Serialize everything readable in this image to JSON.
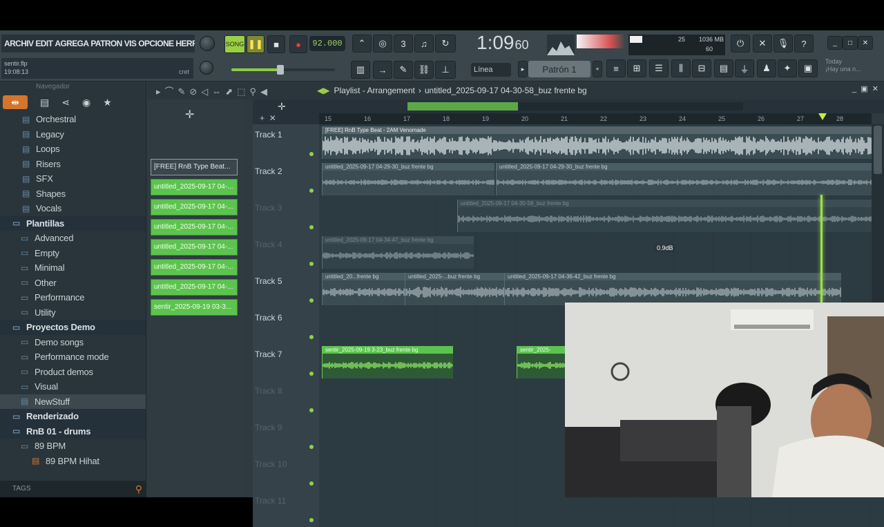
{
  "menu": {
    "items": [
      "ARCHIV",
      "EDIT",
      "AGREGA",
      "PATRON",
      "VIS",
      "OPCIONE",
      "HERRAMIENTA"
    ]
  },
  "song": {
    "file": "sentir.flp",
    "time": "19:08:13",
    "hint": "cret"
  },
  "transport": {
    "tempo": "92.000",
    "time_main": "1:09",
    "time_sub": "60"
  },
  "cpu": {
    "val1": "25",
    "val2": "1036 MB",
    "val3": "60"
  },
  "snap": {
    "label": "Línea"
  },
  "pattern_selector": {
    "label": "Patrón 1"
  },
  "hint_right": {
    "line1": "Today",
    "line2": "¡Hay una n..."
  },
  "browser": {
    "title": "Navegador",
    "items": [
      {
        "label": "Orchestral",
        "type": "file"
      },
      {
        "label": "Legacy",
        "type": "file"
      },
      {
        "label": "Loops",
        "type": "file"
      },
      {
        "label": "Risers",
        "type": "file"
      },
      {
        "label": "SFX",
        "type": "file"
      },
      {
        "label": "Shapes",
        "type": "file"
      },
      {
        "label": "Vocals",
        "type": "file"
      },
      {
        "label": "Plantillas",
        "type": "section"
      },
      {
        "label": "Advanced",
        "type": "folder"
      },
      {
        "label": "Empty",
        "type": "folder"
      },
      {
        "label": "Minimal",
        "type": "folder"
      },
      {
        "label": "Other",
        "type": "folder"
      },
      {
        "label": "Performance",
        "type": "folder"
      },
      {
        "label": "Utility",
        "type": "folder"
      },
      {
        "label": "Proyectos Demo",
        "type": "section"
      },
      {
        "label": "Demo songs",
        "type": "folder"
      },
      {
        "label": "Performance mode",
        "type": "folder"
      },
      {
        "label": "Product demos",
        "type": "folder"
      },
      {
        "label": "Visual",
        "type": "folder"
      },
      {
        "label": "NewStuff",
        "type": "selected"
      },
      {
        "label": "Renderizado",
        "type": "section"
      },
      {
        "label": "RnB 01 - drums",
        "type": "section"
      },
      {
        "label": "89 BPM",
        "type": "folder"
      },
      {
        "label": "89 BPM Hihat",
        "type": "sub"
      }
    ],
    "tags_label": "TAGS"
  },
  "patterns": [
    "[FREE] RnB Type Beat...",
    "untitled_2025-09-17 04-...",
    "untitled_2025-09-17 04-...",
    "untitled_2025-09-17 04-...",
    "untitled_2025-09-17 04-...",
    "untitled_2025-09-17 04-...",
    "untitled_2025-09-17 04-...",
    "sentir_2025-09-19 03-3..."
  ],
  "playlist": {
    "title": "Playlist - Arrangement",
    "separator": "›",
    "subtitle": "untitled_2025-09-17 04-30-58_buz frente bg",
    "ruler": [
      "15",
      "16",
      "17",
      "18",
      "19",
      "20",
      "21",
      "22",
      "23",
      "24",
      "25",
      "26",
      "27",
      "28"
    ],
    "tooltip": "0.9dB"
  },
  "tracks": [
    {
      "name": "Track 1",
      "dim": false,
      "clips": [
        {
          "label": "[FREE] RnB Type Beat - 2AM Venomade",
          "style": "white"
        }
      ]
    },
    {
      "name": "Track 2",
      "dim": false,
      "clips": [
        {
          "label": "untitled_2025-09-17 04-29-30_buz frente bg",
          "style": "normal"
        },
        {
          "label": "untitled_2025-09-17 04-29-30_buz frente bg",
          "style": "normal"
        }
      ]
    },
    {
      "name": "Track 3",
      "dim": true,
      "clips": [
        {
          "label": "untitled_2025-09-17 04-30-58_buz frente bg",
          "style": "normal"
        }
      ]
    },
    {
      "name": "Track 4",
      "dim": true,
      "clips": [
        {
          "label": "untitled_2025-09-17 04-34-47_buz frente bg",
          "style": "normal"
        }
      ]
    },
    {
      "name": "Track 5",
      "dim": false,
      "clips": [
        {
          "label": "untitled_20...frente bg",
          "style": "normal"
        },
        {
          "label": "untitled_2025-...buz frente bg",
          "style": "normal"
        },
        {
          "label": "untitled_2025-09-17 04-36-42_buz frente bg",
          "style": "normal"
        }
      ]
    },
    {
      "name": "Track 6",
      "dim": false,
      "clips": []
    },
    {
      "name": "Track 7",
      "dim": false,
      "clips": [
        {
          "label": "sentir_2025-09-19 3-23_buz frente bg",
          "style": "green"
        },
        {
          "label": "sentir_2025-",
          "style": "green"
        }
      ]
    },
    {
      "name": "Track 8",
      "dim": true,
      "clips": []
    },
    {
      "name": "Track 9",
      "dim": true,
      "clips": []
    },
    {
      "name": "Track 10",
      "dim": true,
      "clips": []
    },
    {
      "name": "Track 11",
      "dim": true,
      "clips": []
    }
  ],
  "colors": {
    "accent": "#5cc44e",
    "playhead": "#9ee04a",
    "browser_active": "#d4752c"
  }
}
